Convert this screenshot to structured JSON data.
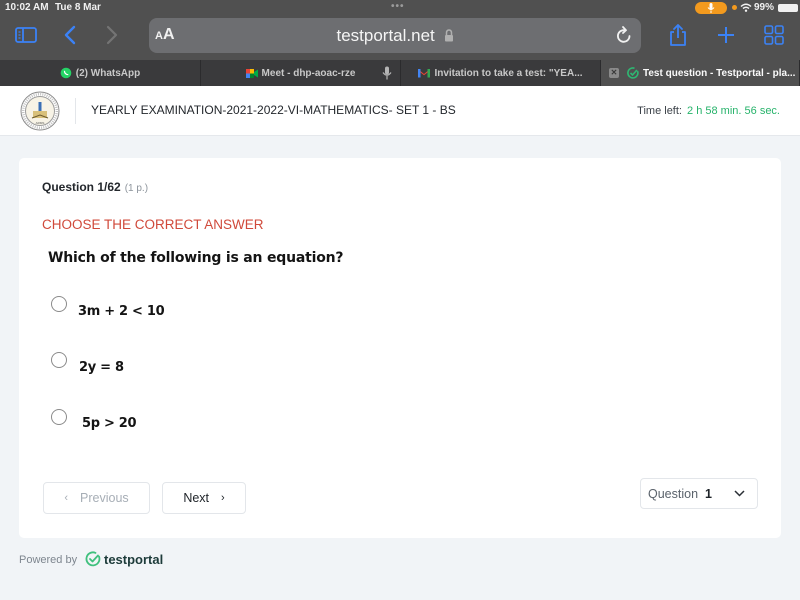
{
  "status_bar": {
    "time": "10:02 AM",
    "date": "Tue 8 Mar",
    "battery": "99%"
  },
  "browser": {
    "text_size_small": "A",
    "text_size_big": "A",
    "url": "testportal.net",
    "tabs": [
      {
        "label": "(2) WhatsApp",
        "icon": "whatsapp-icon",
        "active": false
      },
      {
        "label": "Meet - dhp-aoac-rze",
        "icon": "google-meet-icon",
        "active": false,
        "mic": true
      },
      {
        "label": "Invitation to take a test: \"YEA...",
        "icon": "gmail-icon",
        "active": false
      },
      {
        "label": "Test question - Testportal - pla...",
        "icon": "testportal-icon",
        "active": true
      }
    ],
    "accent_color": "#3b82f6"
  },
  "header": {
    "exam_title": "YEARLY EXAMINATION-2021-2022-VI-MATHEMATICS- SET 1 - BS",
    "time_left_label": "Time left:",
    "time_left_value": "2 h 58 min. 56 sec."
  },
  "question": {
    "number_label": "Question 1/62",
    "points": "(1 p.)",
    "instruction": "CHOOSE THE CORRECT ANSWER",
    "text": "Which of the following is an equation?",
    "options": [
      {
        "text": "3m + 2 <  10",
        "selected": false
      },
      {
        "text": "2y = 8",
        "selected": false
      },
      {
        "text": "5p > 20",
        "selected": false
      }
    ]
  },
  "navigation": {
    "previous_label": "Previous",
    "next_label": "Next",
    "question_select_label": "Question",
    "question_select_value": "1"
  },
  "footer": {
    "powered_by": "Powered by",
    "brand": "testportal"
  }
}
